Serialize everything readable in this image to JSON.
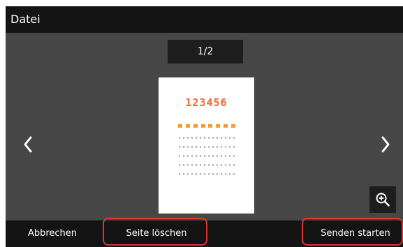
{
  "header": {
    "title": "Datei"
  },
  "preview": {
    "page_indicator": "1/2",
    "document_number": "123456",
    "accent_color": "#f06a3c",
    "dash_color": "#f39a36",
    "line_count": 5
  },
  "navigation": {
    "prev_icon": "chevron-left-icon",
    "next_icon": "chevron-right-icon"
  },
  "zoom": {
    "icon": "zoom-in-icon"
  },
  "footer": {
    "cancel_label": "Abbrechen",
    "delete_page_label": "Seite löschen",
    "start_send_label": "Senden starten"
  },
  "annotation": {
    "highlight_color": "#e0352f"
  }
}
